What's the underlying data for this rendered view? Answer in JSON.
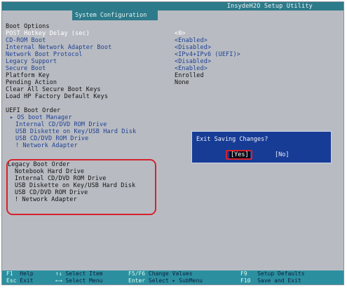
{
  "window": {
    "title": "InsydeH2O Setup Utility"
  },
  "tab": {
    "label": "System Configuration"
  },
  "boot_options": {
    "heading": "Boot Options",
    "items": [
      {
        "label": "POST Hotkey Delay (sec)",
        "value": "<0>"
      },
      {
        "label": "CD-ROM Boot",
        "value": "<Enabled>"
      },
      {
        "label": "Internal Network Adapter Boot",
        "value": "<Disabled>"
      },
      {
        "label": "Network Boot Protocol",
        "value": "<IPv4+IPv6 (UEFI)>"
      },
      {
        "label": "Legacy Support",
        "value": "<Disabled>"
      },
      {
        "label": "Secure Boot",
        "value": "<Enabled>"
      },
      {
        "label": "Platform Key",
        "value": "Enrolled"
      },
      {
        "label": "Pending Action",
        "value": "None"
      }
    ],
    "actions": [
      "Clear All Secure Boot Keys",
      "Load HP Factory Default Keys"
    ]
  },
  "uefi_boot_order": {
    "heading": "UEFI Boot Order",
    "items": [
      "▸ OS boot Manager",
      "Internal CD/DVD ROM Drive",
      "USB Diskette on Key/USB Hard Disk",
      "USB CD/DVD ROM Drive",
      "! Network Adapter"
    ]
  },
  "legacy_boot_order": {
    "heading": "Legacy Boot Order",
    "items": [
      "Notebook Hard Drive",
      "Internal CD/DVD ROM Drive",
      "USB Diskette on Key/USB Hard Disk",
      "USB CD/DVD ROM Drive",
      "! Network Adapter"
    ]
  },
  "dialog": {
    "title": "Exit Saving Changes?",
    "yes": "[Yes]",
    "no": "[No]"
  },
  "footer": [
    {
      "key": "F1",
      "desc": "Help"
    },
    {
      "key": "Esc",
      "desc": "Exit"
    },
    {
      "key": "↑↓",
      "desc": "Select Item"
    },
    {
      "key": "←→",
      "desc": "Select Menu"
    },
    {
      "key": "F5/F6",
      "desc": "Change Values"
    },
    {
      "key": "Enter",
      "desc": "Select ▸ SubMenu"
    },
    {
      "key": "F9",
      "desc": "Setup Defaults"
    },
    {
      "key": "F10",
      "desc": "Save and Exit"
    }
  ],
  "colors": {
    "screen_bg": "#b8bcc2",
    "title_bar": "#2d7a8a",
    "selected_text": "#ffffff",
    "option_text": "#1e3f93",
    "dialog_bg": "#173c95",
    "annotation_red": "#d6222c",
    "footer_bg": "#2b8fa0"
  }
}
